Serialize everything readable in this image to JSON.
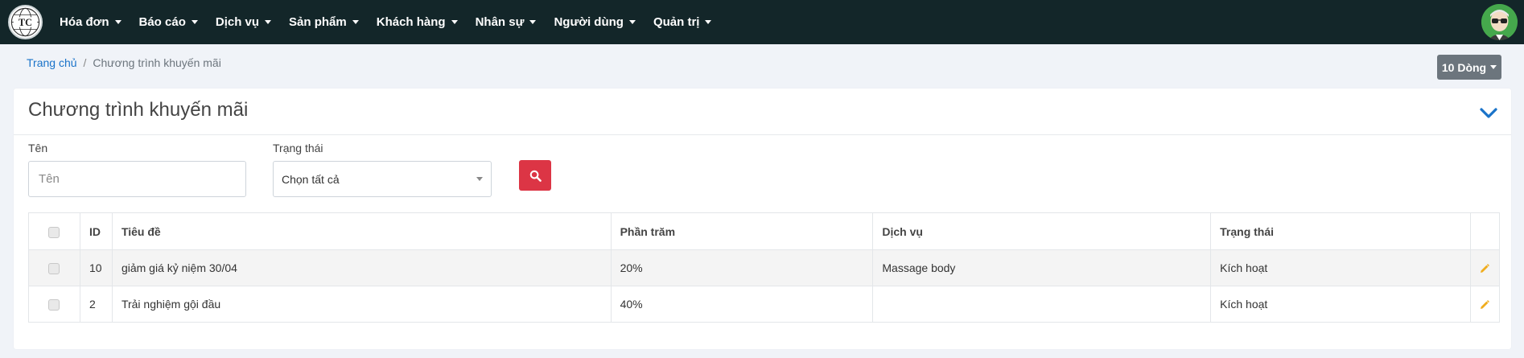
{
  "navbar": {
    "logo_text": "TC",
    "menu": [
      {
        "label": "Hóa đơn"
      },
      {
        "label": "Báo cáo"
      },
      {
        "label": "Dịch vụ"
      },
      {
        "label": "Sản phẩm"
      },
      {
        "label": "Khách hàng"
      },
      {
        "label": "Nhân sự"
      },
      {
        "label": "Người dùng"
      },
      {
        "label": "Quản trị"
      }
    ]
  },
  "breadcrumb": {
    "home": "Trang chủ",
    "separator": "/",
    "current": "Chương trình khuyến mãi"
  },
  "rows_button": {
    "label": "10 Dòng"
  },
  "card": {
    "title": "Chương trình khuyến mãi"
  },
  "filters": {
    "name_label": "Tên",
    "name_placeholder": "Tên",
    "status_label": "Trạng thái",
    "status_selected": "Chọn tất cả"
  },
  "table": {
    "headers": {
      "id": "ID",
      "title": "Tiêu đề",
      "percent": "Phần trăm",
      "service": "Dịch vụ",
      "status": "Trạng thái"
    },
    "rows": [
      {
        "id": "10",
        "title": "giảm giá kỷ niệm 30/04",
        "percent": "20%",
        "service": "Massage body",
        "status": "Kích hoạt"
      },
      {
        "id": "2",
        "title": "Trải nghiệm gội đầu",
        "percent": "40%",
        "service": "",
        "status": "Kích hoạt"
      }
    ]
  },
  "colors": {
    "navbar_bg": "#132629",
    "link": "#1a73c9",
    "search_button": "#dc3545",
    "edit_icon": "#f0ad1e",
    "collapse_icon": "#1a73c9"
  },
  "icons": {
    "search": "search-icon",
    "collapse": "chevron-down-icon",
    "edit": "pencil-icon"
  }
}
